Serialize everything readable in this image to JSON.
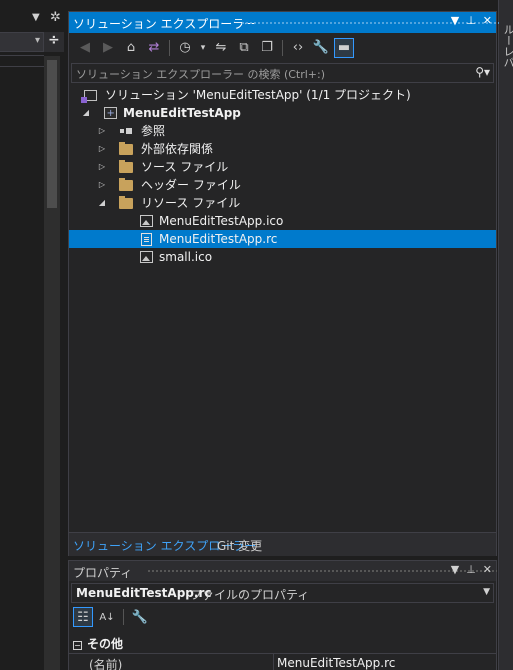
{
  "left": {
    "gear_icon": "gear-icon",
    "split_icon": "split-icon"
  },
  "right_edge": {
    "vertical_text": "ルーレバ"
  },
  "solution_explorer": {
    "title": "ソリューション エクスプローラー",
    "toolbar": [
      "back",
      "forward",
      "home",
      "switch-views",
      "history",
      "sync",
      "collapse-all",
      "show-all-files",
      "view-code",
      "properties",
      "preview"
    ],
    "search_placeholder": "ソリューション エクスプローラー の検索 (Ctrl+:)",
    "tree": {
      "solution": "ソリューション 'MenuEditTestApp' (1/1 プロジェクト)",
      "project": "MenuEditTestApp",
      "references": "参照",
      "external_deps": "外部依存関係",
      "source_files": "ソース ファイル",
      "header_files": "ヘッダー ファイル",
      "resource_files": "リソース ファイル",
      "file1": "MenuEditTestApp.ico",
      "file2": "MenuEditTestApp.rc",
      "file3": "small.ico"
    },
    "tabs": {
      "active": "ソリューション エクスプローラー",
      "other": "Git 変更"
    },
    "accent_color": "#007acc"
  },
  "properties": {
    "title": "プロパティ",
    "object_name": "MenuEditTestApp.rc",
    "object_desc": "ファイルのプロパティ",
    "category": "その他",
    "row_key": "(名前)",
    "row_value": "MenuEditTestApp.rc"
  }
}
